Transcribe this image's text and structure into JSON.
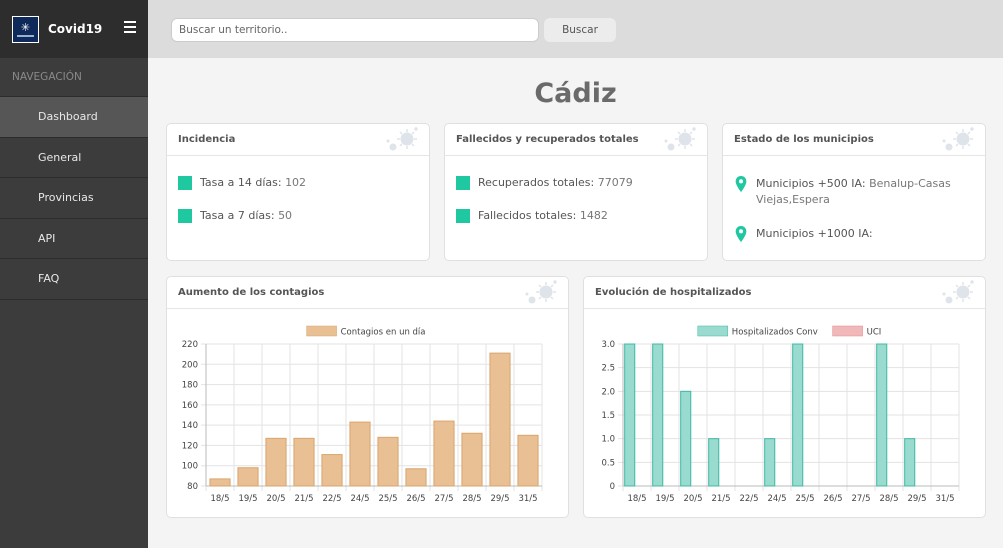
{
  "sidebar": {
    "brand": "Covid19",
    "nav_header": "NAVEGACIÓN",
    "items": [
      {
        "label": "Dashboard",
        "active": true
      },
      {
        "label": "General"
      },
      {
        "label": "Provincias"
      },
      {
        "label": "API"
      },
      {
        "label": "FAQ"
      }
    ]
  },
  "search": {
    "placeholder": "Buscar un territorio..",
    "button": "Buscar"
  },
  "page_title": "Cádiz",
  "incidencia": {
    "title": "Incidencia",
    "rate14_label": "Tasa a 14 días:",
    "rate14_value": "102",
    "rate7_label": "Tasa a 7 días:",
    "rate7_value": "50"
  },
  "fallecidos": {
    "title": "Fallecidos y recuperados totales",
    "recovered_label": "Recuperados totales:",
    "recovered_value": "77079",
    "deaths_label": "Fallecidos totales:",
    "deaths_value": "1482"
  },
  "municipios": {
    "title": "Estado de los municipios",
    "m500_label": "Municipios +500 IA:",
    "m500_value": "Benalup-Casas Viejas,Espera",
    "m1000_label": "Municipios +1000 IA:",
    "m1000_value": ""
  },
  "colors": {
    "accent": "#1fc8a0",
    "bar1": "#e8c093",
    "bar_hosp": "#9adbd0",
    "bar_uci": "#f0b8b8"
  },
  "chart_data": [
    {
      "type": "bar",
      "title": "Aumento de los contagios",
      "categories": [
        "18/5",
        "19/5",
        "20/5",
        "21/5",
        "22/5",
        "24/5",
        "25/5",
        "26/5",
        "27/5",
        "28/5",
        "29/5",
        "31/5"
      ],
      "series": [
        {
          "name": "Contagios en un día",
          "values": [
            87,
            98,
            127,
            127,
            111,
            143,
            128,
            97,
            144,
            132,
            211,
            130
          ]
        }
      ],
      "ylim": [
        80,
        220
      ],
      "yticks": [
        80,
        100,
        120,
        140,
        160,
        180,
        200,
        220
      ],
      "legend": "top-center",
      "grid": true
    },
    {
      "type": "bar",
      "title": "Evolución de hospitalizados",
      "categories": [
        "18/5",
        "19/5",
        "20/5",
        "21/5",
        "22/5",
        "24/5",
        "25/5",
        "26/5",
        "27/5",
        "28/5",
        "29/5",
        "31/5"
      ],
      "series": [
        {
          "name": "Hospitalizados Conv",
          "values": [
            3,
            3,
            2,
            1,
            0,
            1,
            3,
            0,
            0,
            3,
            1,
            0
          ]
        },
        {
          "name": "UCI",
          "values": [
            0,
            0,
            0,
            0,
            0,
            0,
            0,
            0,
            0,
            0,
            0,
            0
          ]
        }
      ],
      "ylim": [
        0,
        3
      ],
      "yticks": [
        "0",
        "0.5",
        "1.0",
        "1.5",
        "2.0",
        "2.5",
        "3.0"
      ],
      "legend": "top-center",
      "grid": true
    }
  ]
}
